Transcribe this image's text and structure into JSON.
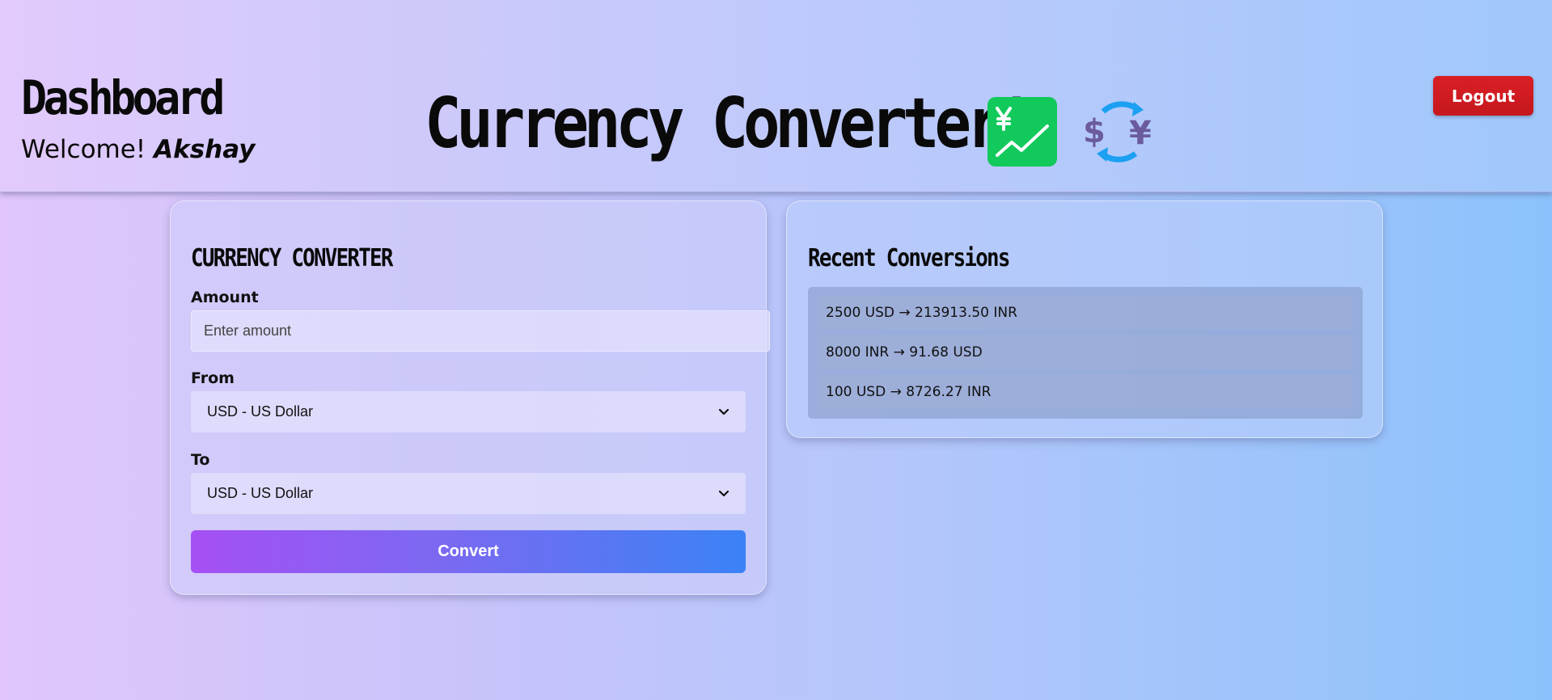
{
  "header": {
    "dashboard_title": "Dashboard",
    "welcome_prefix": "Welcome!",
    "user_name": "Akshay",
    "main_title": "Currency Converter!",
    "logout_label": "Logout"
  },
  "converter": {
    "heading": "CURRENCY CONVERTER",
    "amount_label": "Amount",
    "amount_placeholder": "Enter amount",
    "amount_value": "",
    "from_label": "From",
    "from_selected": "USD - US Dollar",
    "to_label": "To",
    "to_selected": "USD - US Dollar",
    "convert_label": "Convert"
  },
  "recent": {
    "heading": "Recent Conversions",
    "items": [
      "2500 USD → 213913.50 INR",
      "8000 INR → 91.68 USD",
      "100 USD → 8726.27 INR"
    ]
  },
  "icons": {
    "chart": "chart-increasing-with-yen-icon",
    "exchange": "currency-exchange-icon",
    "chevron": "chevron-down-icon"
  },
  "colors": {
    "logout": "#d91f25",
    "convert_start": "#a64ff5",
    "convert_end": "#3b82f6",
    "chart_icon": "#12c95c"
  }
}
